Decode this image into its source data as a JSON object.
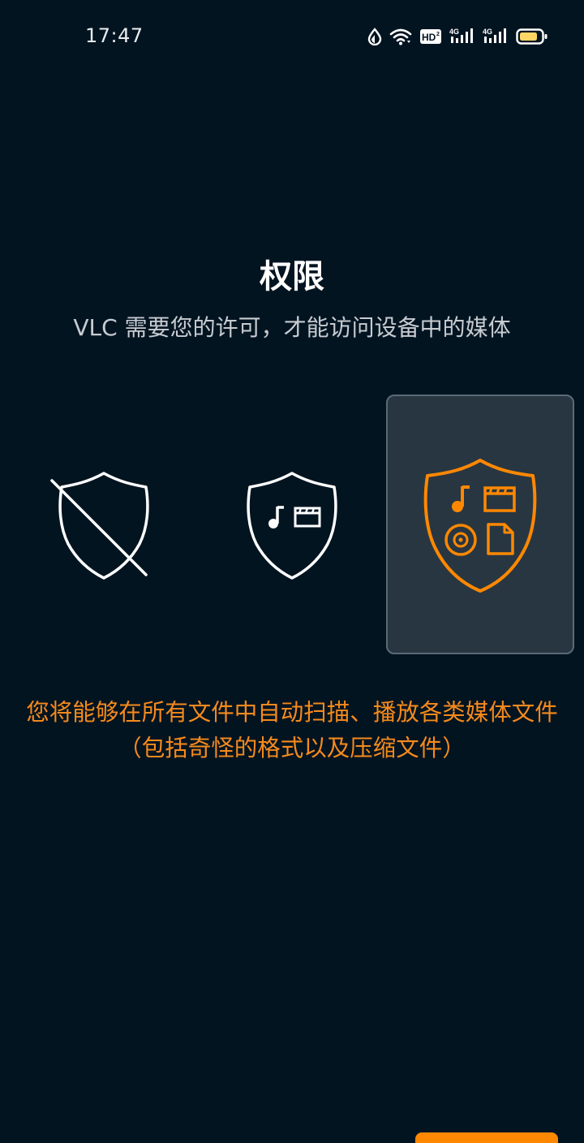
{
  "status_bar": {
    "time": "17:47",
    "icons": [
      "data-saver-icon",
      "wifi-icon",
      "hd-voice-icon",
      "signal-4g-icon",
      "signal-4g-icon",
      "battery-icon"
    ],
    "hd_label": "HD",
    "network_label": "4G"
  },
  "permissions": {
    "title": "权限",
    "subtitle": "VLC 需要您的许可，才能访问设备中的媒体",
    "options": [
      {
        "id": "none",
        "icon": "shield-off-icon",
        "selected": false
      },
      {
        "id": "media",
        "icon": "shield-media-icon",
        "selected": false
      },
      {
        "id": "all",
        "icon": "shield-all-files-icon",
        "selected": true
      }
    ],
    "description": "您将能够在所有文件中自动扫描、播放各类媒体文件（包括奇怪的格式以及压缩文件）"
  },
  "colors": {
    "background": "#031421",
    "accent": "#ff8800",
    "selected_card": "#283642",
    "text_secondary": "#c7ccd1"
  }
}
